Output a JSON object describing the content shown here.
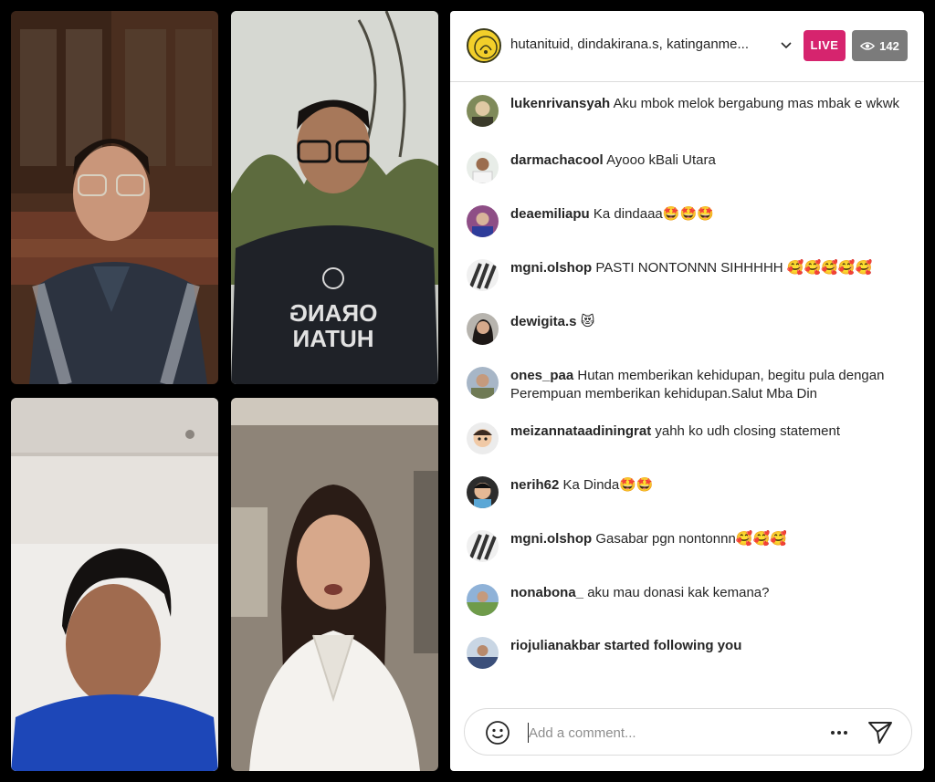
{
  "header": {
    "host_names": "hutanituid, dindakirana.s, katinganme...",
    "live_label": "LIVE",
    "viewer_count": "142",
    "icons": {
      "chevron": "chevron-down-icon",
      "viewers": "eye-icon"
    }
  },
  "comments": [
    {
      "user": "lukenrivansyah",
      "text": "Aku mbok melok bergabung mas mbak e wkwk",
      "emoji": ""
    },
    {
      "user": "darmachacool",
      "text": "Ayooo kBali Utara",
      "emoji": ""
    },
    {
      "user": "deaemiliapu",
      "text": "Ka dindaaa",
      "emoji": "🤩🤩🤩"
    },
    {
      "user": "mgni.olshop",
      "text": "PASTI NONTONNN SIHHHHH",
      "emoji": "🥰🥰🥰🥰🥰"
    },
    {
      "user": "dewigita.s",
      "text": "",
      "emoji": "😻"
    },
    {
      "user": "ones_paa",
      "text": "Hutan memberikan kehidupan, begitu pula dengan Perempuan memberikan kehidupan.Salut Mba Din",
      "emoji": ""
    },
    {
      "user": "meizannataadiningrat",
      "text": "yahh ko udh closing statement",
      "emoji": ""
    },
    {
      "user": "nerih62",
      "text": "Ka Dinda",
      "emoji": "🤩🤩"
    },
    {
      "user": "mgni.olshop",
      "text": "Gasabar pgn nontonnn",
      "emoji": "🥰🥰🥰"
    },
    {
      "user": "nonabona_",
      "text": "aku mau donasi kak kemana?",
      "emoji": ""
    }
  ],
  "follow_notice": {
    "text": "riojulianakbar started following you"
  },
  "comment_box": {
    "placeholder": "Add a comment...",
    "icons": {
      "emoji": "smile-icon",
      "more": "more-icon",
      "send": "send-icon"
    }
  },
  "video_tiles": [
    {
      "participant": "top-left",
      "shirt_text": ""
    },
    {
      "participant": "top-right",
      "shirt_text": "ORANG HUTAN"
    },
    {
      "participant": "bottom-left",
      "shirt_text": ""
    },
    {
      "participant": "bottom-right",
      "shirt_text": ""
    }
  ],
  "colors": {
    "live": "#d6246e",
    "viewers_bg": "#7b7b7b",
    "text": "#262626",
    "placeholder": "#8e8e8e"
  }
}
